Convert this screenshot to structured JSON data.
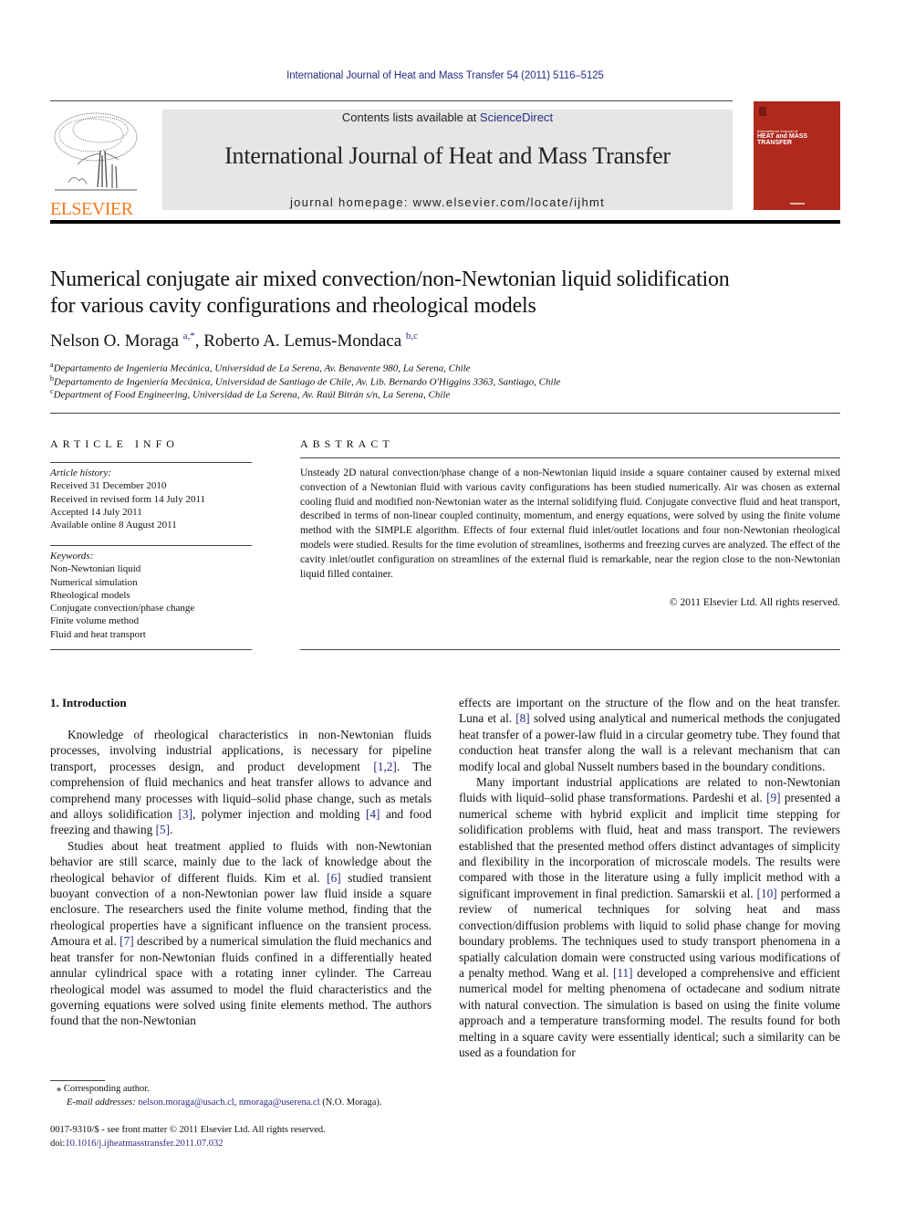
{
  "header": {
    "citation": "International Journal of Heat and Mass Transfer 54 (2011) 5116–5125",
    "contents_prefix": "Contents lists available at ",
    "contents_link": "ScienceDirect",
    "journal_title": "International Journal of Heat and Mass Transfer",
    "homepage": "journal homepage: www.elsevier.com/locate/ijhmt",
    "publisher_logo": "ELSEVIER",
    "publisher_color": "#f47a20",
    "cover": {
      "line1": "International Journal of",
      "line2": "HEAT and MASS",
      "line3": "TRANSFER",
      "color": "#b0281e"
    }
  },
  "article": {
    "title_line1": "Numerical conjugate air mixed convection/non-Newtonian liquid solidification",
    "title_line2": "for various cavity configurations and rheological models",
    "authors": [
      {
        "name": "Nelson O. Moraga",
        "marks": "a,*"
      },
      {
        "name": "Roberto A. Lemus-Mondaca",
        "marks": "b,c"
      }
    ],
    "affiliations": [
      {
        "mark": "a",
        "text": "Departamento de Ingeniería Mecánica, Universidad de La Serena, Av. Benavente 980, La Serena, Chile"
      },
      {
        "mark": "b",
        "text": "Departamento de Ingeniería Mecánica, Universidad de Santiago de Chile, Av. Lib. Bernardo O'Higgins 3363, Santiago, Chile"
      },
      {
        "mark": "c",
        "text": "Department of Food Engineering, Universidad de La Serena, Av. Raúl Bitrán s/n, La Serena, Chile"
      }
    ]
  },
  "article_info": {
    "heading": "ARTICLE INFO",
    "history_label": "Article history:",
    "history": [
      "Received 31 December 2010",
      "Received in revised form 14 July 2011",
      "Accepted 14 July 2011",
      "Available online 8 August 2011"
    ],
    "keywords_label": "Keywords:",
    "keywords": [
      "Non-Newtonian liquid",
      "Numerical simulation",
      "Rheological models",
      "Conjugate convection/phase change",
      "Finite volume method",
      "Fluid and heat transport"
    ]
  },
  "abstract": {
    "heading": "ABSTRACT",
    "text": "Unsteady 2D natural convection/phase change of a non-Newtonian liquid inside a square container caused by external mixed convection of a Newtonian fluid with various cavity configurations has been studied numerically. Air was chosen as external cooling fluid and modified non-Newtonian water as the internal solidifying fluid. Conjugate convective fluid and heat transport, described in terms of non-linear coupled continuity, momentum, and energy equations, were solved by using the finite volume method with the SIMPLE algorithm. Effects of four external fluid inlet/outlet locations and four non-Newtonian rheological models were studied. Results for the time evolution of streamlines, isotherms and freezing curves are analyzed. The effect of the cavity inlet/outlet configuration on streamlines of the external fluid is remarkable, near the region close to the non-Newtonian liquid filled container.",
    "copyright": "© 2011 Elsevier Ltd. All rights reserved."
  },
  "body": {
    "section_heading": "1. Introduction",
    "left_column": [
      {
        "segments": [
          {
            "t": "Knowledge of rheological characteristics in non-Newtonian fluids processes, involving industrial applications, is necessary for pipeline transport, processes design, and product development "
          },
          {
            "ref": "[1,2]"
          },
          {
            "t": ". The comprehension of fluid mechanics and heat transfer allows to advance and comprehend many processes with liquid–solid phase change, such as metals and alloys solidification "
          },
          {
            "ref": "[3]"
          },
          {
            "t": ", polymer injection and molding "
          },
          {
            "ref": "[4]"
          },
          {
            "t": " and food freezing and thawing "
          },
          {
            "ref": "[5]"
          },
          {
            "t": "."
          }
        ]
      },
      {
        "segments": [
          {
            "t": "Studies about heat treatment applied to fluids with non-Newtonian behavior are still scarce, mainly due to the lack of knowledge about the rheological behavior of different fluids. Kim et al. "
          },
          {
            "ref": "[6]"
          },
          {
            "t": " studied transient buoyant convection of a non-Newtonian power law fluid inside a square enclosure. The researchers used the finite volume method, finding that the rheological properties have a significant influence on the transient process. Amoura et al. "
          },
          {
            "ref": "[7]"
          },
          {
            "t": " described by a numerical simulation the fluid mechanics and heat transfer for non-Newtonian fluids confined in a differentially heated annular cylindrical space with a rotating inner cylinder. The Carreau rheological model was assumed to model the fluid characteristics and the governing equations were solved using finite elements method. The authors found that the non-Newtonian"
          }
        ]
      }
    ],
    "right_column": [
      {
        "continuation": true,
        "segments": [
          {
            "t": "effects are important on the structure of the flow and on the heat transfer. Luna et al. "
          },
          {
            "ref": "[8]"
          },
          {
            "t": " solved using analytical and numerical methods the conjugated heat transfer of a power-law fluid in a circular geometry tube. They found that conduction heat transfer along the wall is a relevant mechanism that can modify local and global Nusselt numbers based in the boundary conditions."
          }
        ]
      },
      {
        "segments": [
          {
            "t": "Many important industrial applications are related to non-Newtonian fluids with liquid–solid phase transformations. Pardeshi et al. "
          },
          {
            "ref": "[9]"
          },
          {
            "t": " presented a numerical scheme with hybrid explicit and implicit time stepping for solidification problems with fluid, heat and mass transport. The reviewers established that the presented method offers distinct advantages of simplicity and flexibility in the incorporation of microscale models. The results were compared with those in the literature using a fully implicit method with a significant improvement in final prediction. Samarskii et al. "
          },
          {
            "ref": "[10]"
          },
          {
            "t": " performed a review of numerical techniques for solving heat and mass convection/diffusion problems with liquid to solid phase change for moving boundary problems. The techniques used to study transport phenomena in a spatially calculation domain were constructed using various modifications of a penalty method. Wang et al. "
          },
          {
            "ref": "[11]"
          },
          {
            "t": " developed a comprehensive and efficient numerical model for melting phenomena of octadecane and sodium nitrate with natural convection. The simulation is based on using the finite volume approach and a temperature transforming model. The results found for both melting in a square cavity were essentially identical; such a similarity can be used as a foundation for"
          }
        ]
      }
    ]
  },
  "footnote": {
    "corresponding": "⁎ Corresponding author.",
    "email_label": "E-mail addresses: ",
    "emails": [
      "nelson.moraga@usach.cl",
      "nmoraga@userena.cl"
    ],
    "email_suffix": " (N.O. Moraga)."
  },
  "front_matter": {
    "issn": "0017-9310/$ - see front matter © 2011 Elsevier Ltd. All rights reserved.",
    "doi_prefix": "doi:",
    "doi": "10.1016/j.ijheatmasstransfer.2011.07.032"
  }
}
